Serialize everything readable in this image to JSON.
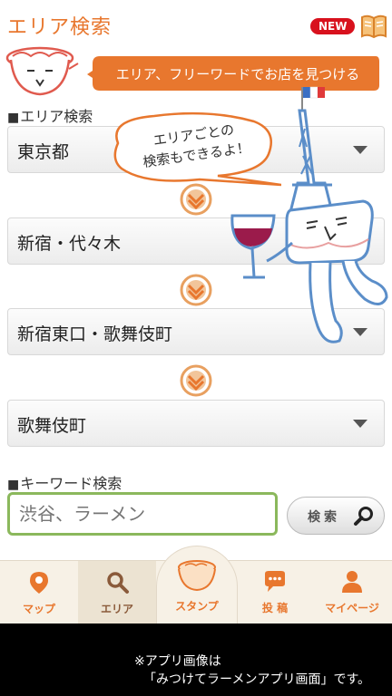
{
  "header": {
    "title": "エリア検索",
    "new_badge": "NEW",
    "book_icon": "book-icon"
  },
  "banner": {
    "text": "エリア、フリーワードでお店を見つける"
  },
  "bubble": {
    "text_line1": "エリアごとの",
    "text_line2": "検索もできるよ！"
  },
  "area_section": {
    "label": "エリア検索",
    "dropdowns": [
      {
        "value": "東京都"
      },
      {
        "value": "新宿・代々木"
      },
      {
        "value": "新宿東口・歌舞伎町"
      },
      {
        "value": "歌舞伎町"
      }
    ]
  },
  "keyword_section": {
    "label": "キーワード検索",
    "placeholder": "渋谷、ラーメン",
    "button_label": "検索"
  },
  "tabs": [
    {
      "label": "マップ",
      "icon": "map-pin-icon"
    },
    {
      "label": "エリア",
      "icon": "search-icon",
      "active": true
    },
    {
      "label": "スタンプ",
      "icon": "ramen-bowl-icon"
    },
    {
      "label": "投 稿",
      "icon": "speech-bubble-icon"
    },
    {
      "label": "マイページ",
      "icon": "person-icon"
    }
  ],
  "footer": {
    "line1": "※アプリ画像は",
    "line2": "「みつけてラーメンアプリ画面」です。"
  },
  "colors": {
    "accent": "#e8772e",
    "badge": "#d8111d",
    "input_border": "#8bb85c",
    "footer_bg": "#000000"
  }
}
